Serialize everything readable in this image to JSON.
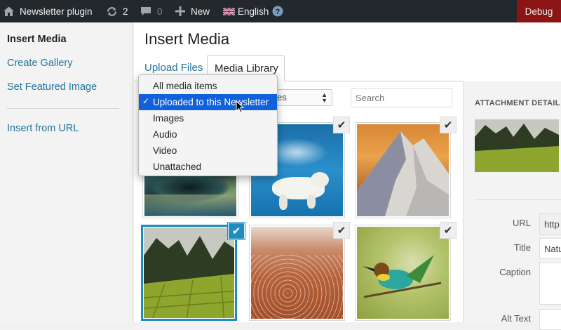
{
  "admin_bar": {
    "site_name": "Newsletter plugin",
    "updates_count": "2",
    "comments_count": "0",
    "new_label": "New",
    "language_label": "English",
    "debug_label": "Debug"
  },
  "sidebar": {
    "items": [
      {
        "label": "Insert Media"
      },
      {
        "label": "Create Gallery"
      },
      {
        "label": "Set Featured Image"
      },
      {
        "label": "Insert from URL"
      }
    ]
  },
  "main": {
    "title": "Insert Media",
    "tabs": [
      {
        "label": "Upload Files"
      },
      {
        "label": "Media Library"
      }
    ],
    "filter_value": "es",
    "search_placeholder": "Search"
  },
  "dropdown": {
    "options": [
      {
        "label": "All media items"
      },
      {
        "label": "Uploaded to this Newsletter",
        "selected": true
      },
      {
        "label": "Images"
      },
      {
        "label": "Audio"
      },
      {
        "label": "Video"
      },
      {
        "label": "Unattached"
      }
    ],
    "tick": "✓"
  },
  "media_items": [
    {
      "name": "abstract-image",
      "checked": false
    },
    {
      "name": "polar-bear-image",
      "checked": true
    },
    {
      "name": "snowy-mountain-image",
      "checked": true
    },
    {
      "name": "green-valley-image",
      "checked": true,
      "selected": true
    },
    {
      "name": "flamingos-image",
      "checked": true
    },
    {
      "name": "bee-eater-bird-image",
      "checked": true
    }
  ],
  "attachment_details": {
    "heading": "ATTACHMENT DETAIL",
    "fields": [
      {
        "label": "URL",
        "value": "http"
      },
      {
        "label": "Title",
        "value": "Natu"
      },
      {
        "label": "Caption",
        "value": ""
      },
      {
        "label": "Alt Text",
        "value": ""
      }
    ]
  },
  "colors": {
    "link": "#21759b",
    "selected_border": "#1e8cbe",
    "dropdown_highlight": "#1160dc",
    "admin_bar": "#23282d",
    "debug_bg": "#8b1515"
  }
}
